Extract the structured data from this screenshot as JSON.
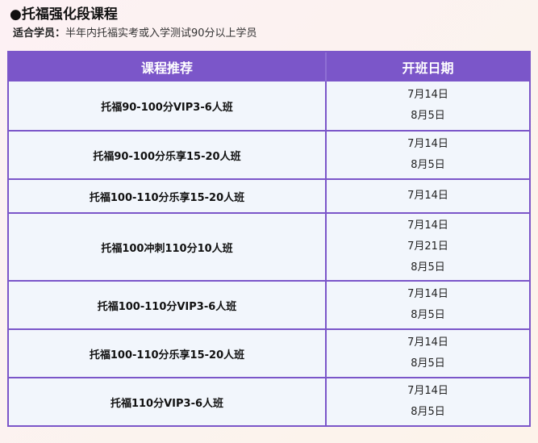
{
  "heading": "●托福强化段课程",
  "audience": {
    "label": "适合学员：",
    "text": "半年内托福实考或入学测试90分以上学员"
  },
  "table": {
    "headers": {
      "course": "课程推荐",
      "dates": "开班日期"
    },
    "rows": [
      {
        "course": "托福90-100分VIP3-6人班",
        "dates": [
          "7月14日",
          "8月5日"
        ]
      },
      {
        "course": "托福90-100分乐享15-20人班",
        "dates": [
          "7月14日",
          "8月5日"
        ]
      },
      {
        "course": "托福100-110分乐享15-20人班",
        "dates": [
          "7月14日"
        ]
      },
      {
        "course": "托福100冲刺110分10人班",
        "dates": [
          "7月14日",
          "7月21日",
          "8月5日"
        ]
      },
      {
        "course": "托福100-110分VIP3-6人班",
        "dates": [
          "7月14日",
          "8月5日"
        ]
      },
      {
        "course": "托福100-110分乐享15-20人班",
        "dates": [
          "7月14日",
          "8月5日"
        ]
      },
      {
        "course": "托福110分VIP3-6人班",
        "dates": [
          "7月14日",
          "8月5日"
        ]
      }
    ]
  }
}
